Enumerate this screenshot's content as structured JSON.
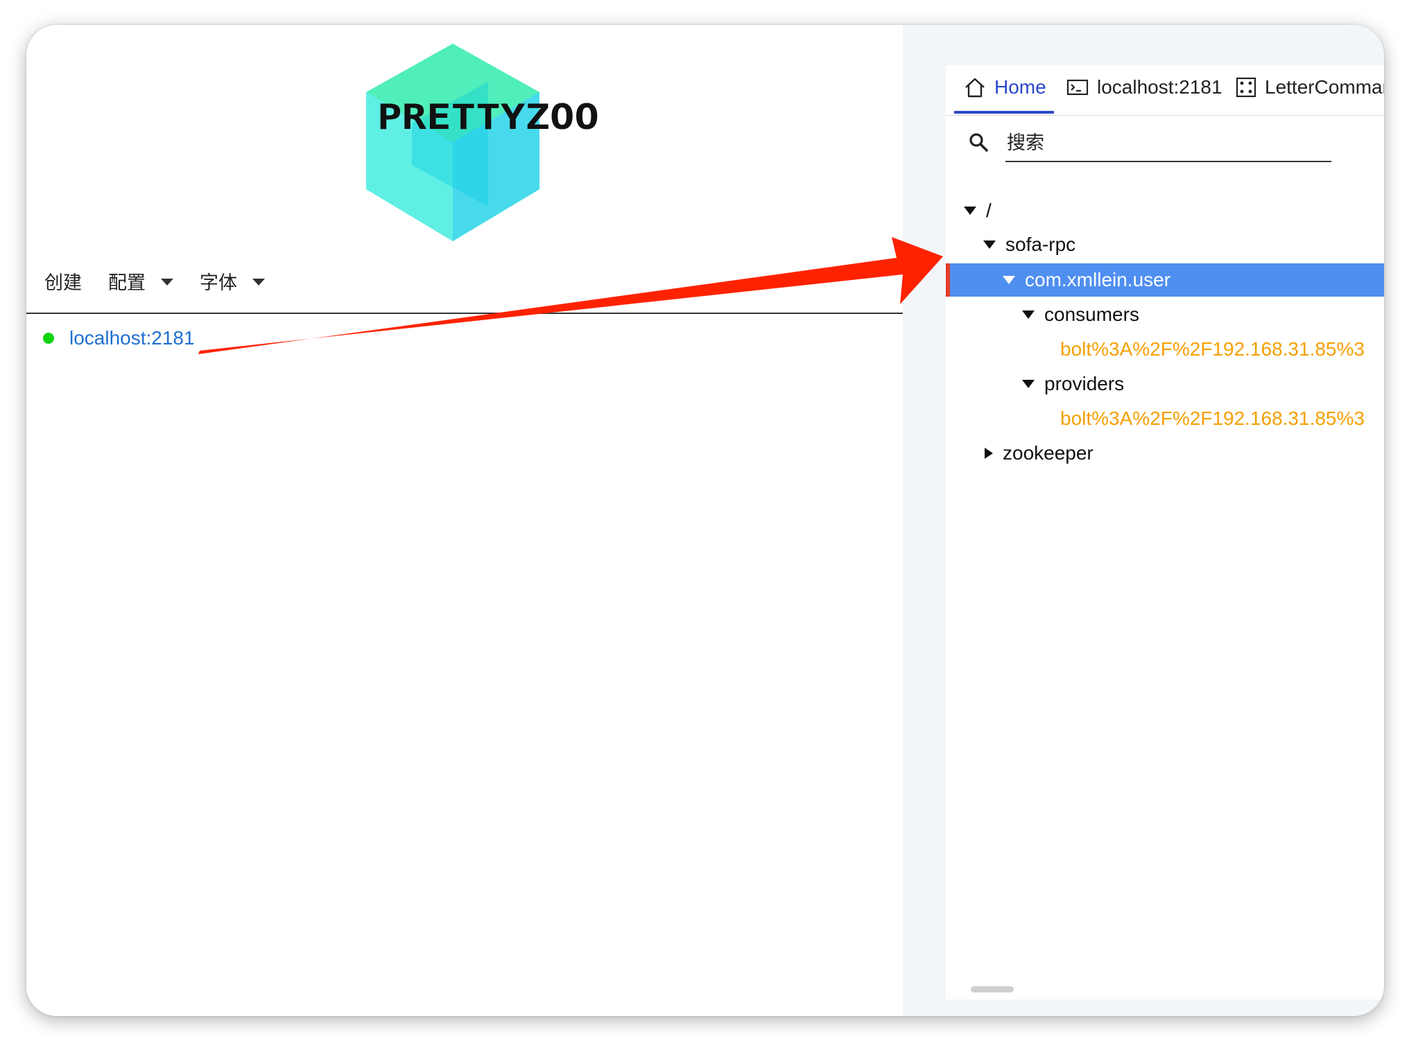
{
  "app": {
    "logo_text": "PRETTYZOO"
  },
  "menu": {
    "create_label": "创建",
    "config_label": "配置",
    "font_label": "字体"
  },
  "servers": [
    {
      "label": "localhost:2181",
      "status": "connected",
      "status_color": "#0fd30f"
    }
  ],
  "tabs": [
    {
      "label": "Home",
      "icon": "home-icon",
      "active": true
    },
    {
      "label": "localhost:2181",
      "icon": "terminal-icon",
      "active": false
    },
    {
      "label": "LetterCommar",
      "icon": "dice-icon",
      "active": false
    }
  ],
  "search": {
    "placeholder": "搜索"
  },
  "tree": [
    {
      "label": "/",
      "expanded": true
    },
    {
      "label": "sofa-rpc",
      "expanded": true
    },
    {
      "label": "com.xmllein.user",
      "expanded": true,
      "selected": true
    },
    {
      "label": "consumers",
      "expanded": true
    },
    {
      "label": "bolt%3A%2F%2F192.168.31.85%3"
    },
    {
      "label": "providers",
      "expanded": true
    },
    {
      "label": "bolt%3A%2F%2F192.168.31.85%3"
    },
    {
      "label": "zookeeper",
      "expanded": false
    }
  ],
  "colors": {
    "accent": "#2b47c9",
    "selected_row": "#4f8ff0",
    "leaf_node": "#f5a000",
    "link": "#1f6fd0",
    "annotation_arrow": "#ff2200"
  }
}
